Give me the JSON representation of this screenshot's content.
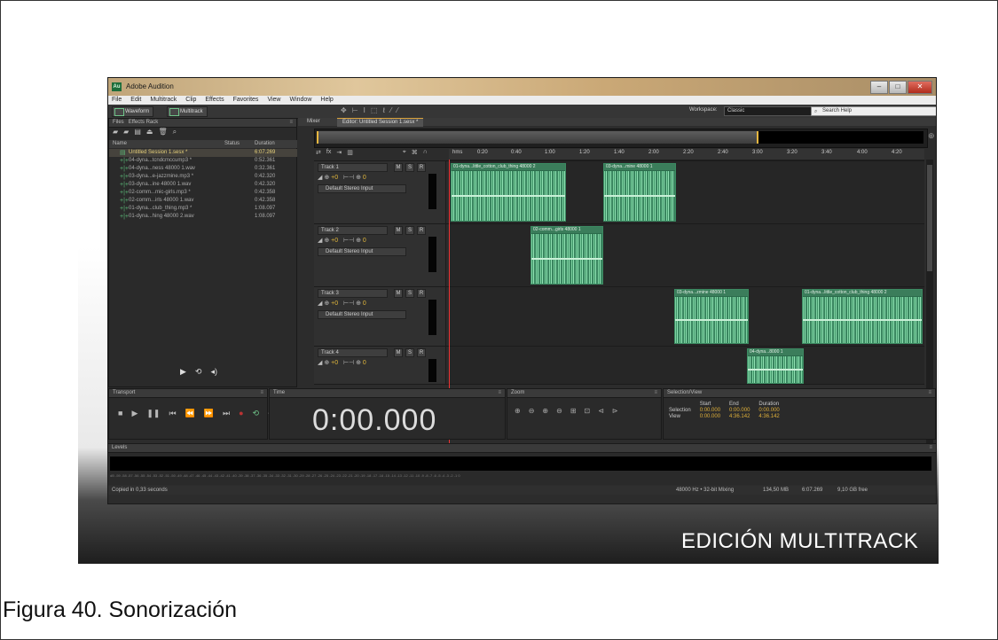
{
  "slide": {
    "title": "EDICIÓN MULTITRACK"
  },
  "caption": "Figura 40. Sonorización",
  "app": {
    "title": "Adobe Audition",
    "logo": "Au",
    "menu": [
      "File",
      "Edit",
      "Multitrack",
      "Clip",
      "Effects",
      "Favorites",
      "View",
      "Window",
      "Help"
    ],
    "toolbar": {
      "waveform": "Waveform",
      "multitrack": "Multitrack",
      "workspace_label": "Workspace:",
      "workspace_value": "Classic",
      "search_placeholder": "Search Help"
    }
  },
  "files_panel": {
    "tabs": [
      "Files",
      "Effects Rack"
    ],
    "columns": {
      "name": "Name",
      "status": "Status",
      "duration": "Duration"
    },
    "items": [
      {
        "name": "Untitled Session 1.sesx *",
        "duration": "6:07.269",
        "selected": true
      },
      {
        "name": "04-dyna...tcndcmccump3 *",
        "duration": "0:52.361"
      },
      {
        "name": "04-dyna...ness 48000 1.wav",
        "duration": "0:32.361"
      },
      {
        "name": "03-dyna...e-jazzmine.mp3 *",
        "duration": "0:42.320"
      },
      {
        "name": "03-dyna...ine 48000 1.wav",
        "duration": "0:42.320"
      },
      {
        "name": "02-comm...mic-girls.mp3 *",
        "duration": "0:42.358"
      },
      {
        "name": "02-comm...irls 48000 1.wav",
        "duration": "0:42.358"
      },
      {
        "name": "01-dyna...club_thing.mp3 *",
        "duration": "1:08.097"
      },
      {
        "name": "01-dyna...hing 48000 2.wav",
        "duration": "1:08.097"
      }
    ]
  },
  "editor": {
    "tabs": [
      "Mixer",
      "Editor: Untitled Session 1.sesx *"
    ],
    "ruler": [
      "hms",
      "0:20",
      "0:40",
      "1:00",
      "1:20",
      "1:40",
      "2:00",
      "2:20",
      "2:40",
      "3:00",
      "3:20",
      "3:40",
      "4:00",
      "4:20"
    ],
    "tracks": [
      {
        "name": "Track 1",
        "input": "Default Stereo Input",
        "vol": "+0",
        "pan": "0",
        "clips": [
          {
            "label": "01-dyna...little_cotton_club_thing 48000 2"
          },
          {
            "label": "03-dyna...mine 48000 1"
          }
        ]
      },
      {
        "name": "Track 2",
        "input": "Default Stereo Input",
        "vol": "+0",
        "pan": "0",
        "clips": [
          {
            "label": "02-comm...girls 48000 1"
          }
        ]
      },
      {
        "name": "Track 3",
        "input": "Default Stereo Input",
        "vol": "+0",
        "pan": "0",
        "clips": [
          {
            "label": "03-dyna...zmine 48000 1"
          },
          {
            "label": "01-dyna...little_cotton_club_thing 48000 2"
          }
        ]
      },
      {
        "name": "Track 4",
        "input": "Default Stereo Input",
        "vol": "+0",
        "pan": "0",
        "clips": [
          {
            "label": "04-dyna...8000 1"
          }
        ]
      }
    ],
    "msr": [
      "M",
      "S",
      "R"
    ]
  },
  "transport": {
    "label": "Transport"
  },
  "time": {
    "label": "Time",
    "value": "0:00.000"
  },
  "zoom": {
    "label": "Zoom"
  },
  "selection": {
    "label": "Selection/View",
    "headers": [
      "Start",
      "End",
      "Duration"
    ],
    "rows": [
      {
        "name": "Selection",
        "start": "0:00.000",
        "end": "0:00.000",
        "duration": "0:00.000"
      },
      {
        "name": "View",
        "start": "0:00.000",
        "end": "4:36.142",
        "duration": "4:36.142"
      }
    ]
  },
  "levels": {
    "label": "Levels",
    "scale": "dB -59 -58 -57 -56 -55 -54 -53 -52 -51 -50 -49 -48 -47 -46 -45 -44 -43 -42 -41 -40 -39 -38 -37 -36 -35 -34 -33 -32 -31 -30 -29 -28 -27 -26 -25 -24 -23 -22 -21 -20 -19 -18 -17 -16 -15 -14 -13 -12 -11 -10 -9 -8 -7 -6 -5 -4 -3 -2 -1 0"
  },
  "status": {
    "left": "Copied in 0,33 seconds",
    "format": "48000 Hz • 32-bit Mixing",
    "size": "134,50 MB",
    "duration": "6:07.269",
    "free": "9,10 GB free"
  }
}
